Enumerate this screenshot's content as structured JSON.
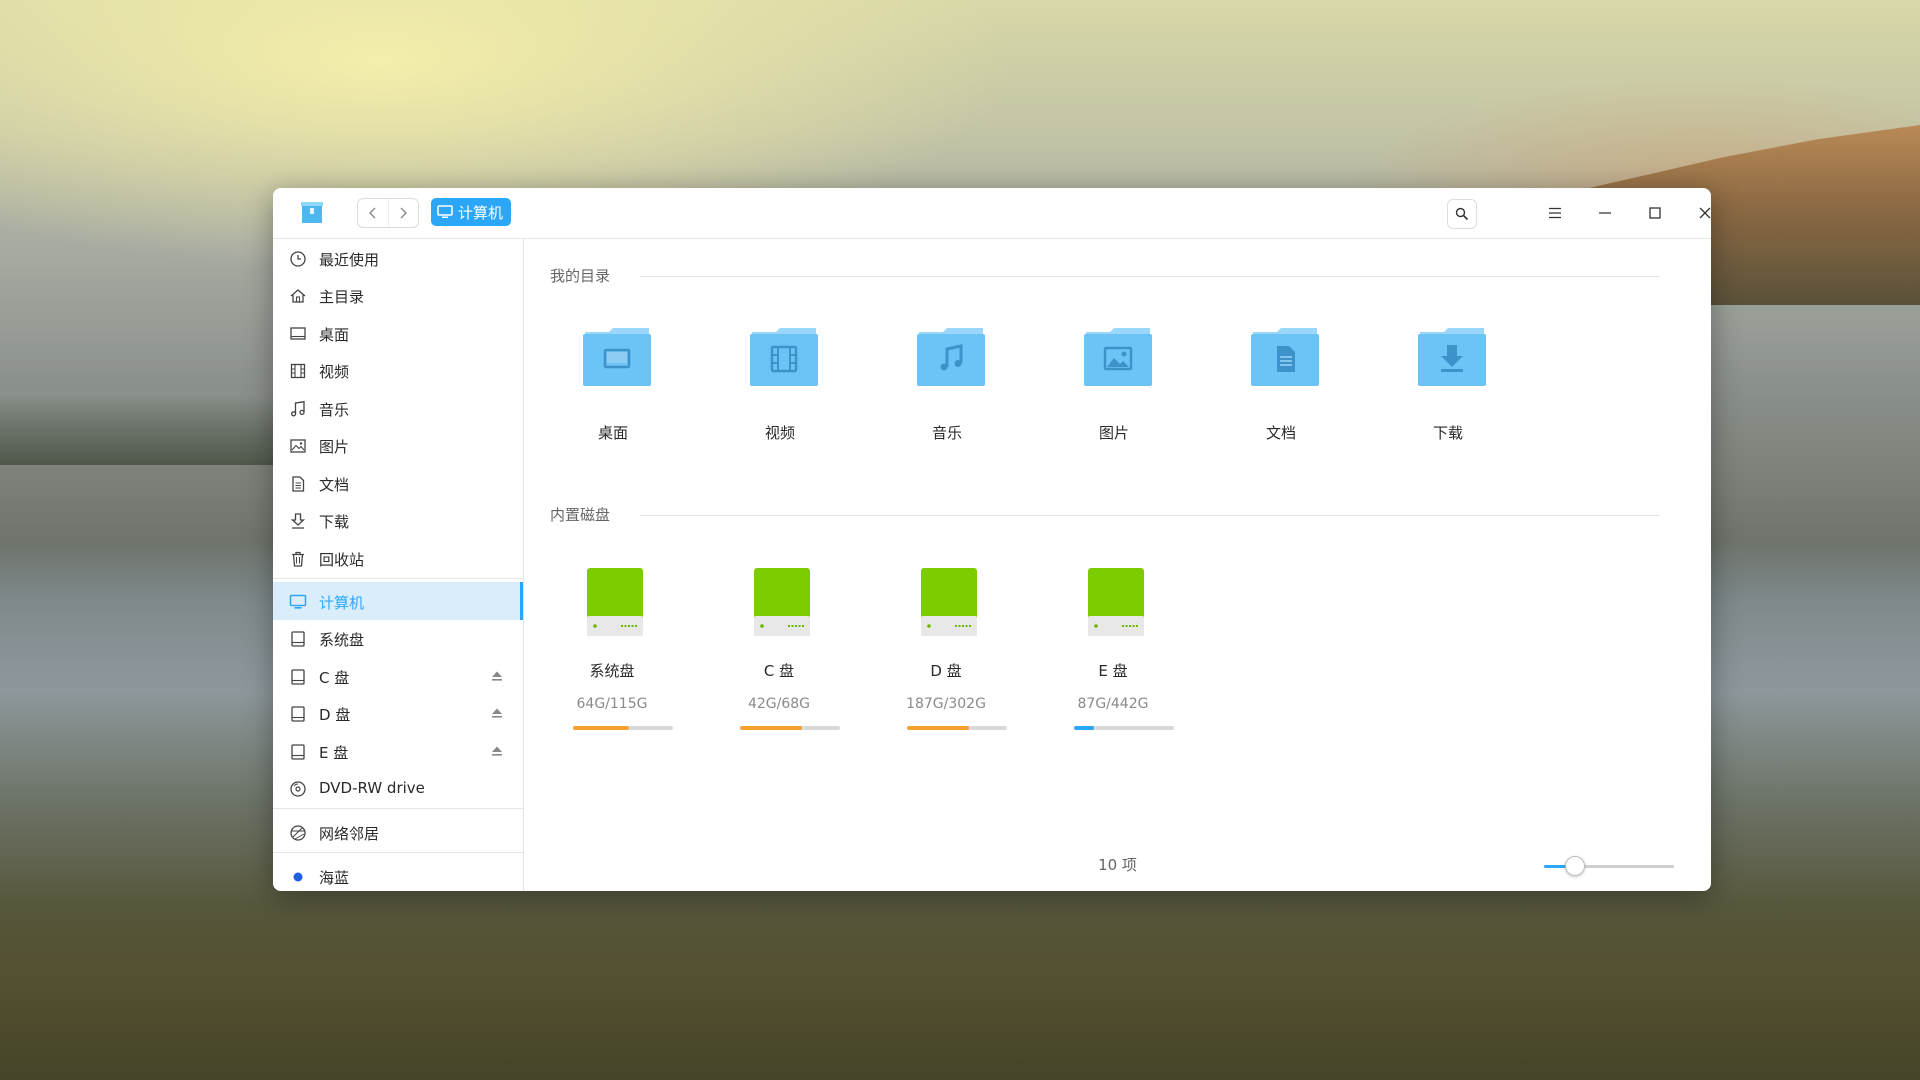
{
  "window": {
    "breadcrumb": "计算机",
    "controls": [
      "search-icon",
      "menu-icon",
      "minimize-icon",
      "maximize-icon",
      "close-icon"
    ]
  },
  "sidebar": {
    "items": [
      {
        "label": "最近使用",
        "icon": "clock-icon"
      },
      {
        "label": "主目录",
        "icon": "home-icon"
      },
      {
        "label": "桌面",
        "icon": "desktop-icon"
      },
      {
        "label": "视频",
        "icon": "video-icon"
      },
      {
        "label": "音乐",
        "icon": "music-icon"
      },
      {
        "label": "图片",
        "icon": "image-icon"
      },
      {
        "label": "文档",
        "icon": "document-icon"
      },
      {
        "label": "下载",
        "icon": "download-icon"
      },
      {
        "label": "回收站",
        "icon": "trash-icon"
      },
      {
        "label": "计算机",
        "icon": "computer-icon",
        "active": true
      },
      {
        "label": "系统盘",
        "icon": "disk-icon"
      },
      {
        "label": "C 盘",
        "icon": "disk-icon",
        "eject": true
      },
      {
        "label": "D 盘",
        "icon": "disk-icon",
        "eject": true
      },
      {
        "label": "E 盘",
        "icon": "disk-icon",
        "eject": true
      },
      {
        "label": "DVD-RW drive",
        "icon": "optical-drive-icon"
      },
      {
        "label": "网络邻居",
        "icon": "network-icon"
      },
      {
        "label": "海蓝",
        "icon": "tag-dot-icon",
        "color": "#2060e0"
      }
    ]
  },
  "content": {
    "my_dirs_title": "我的目录",
    "folders": [
      {
        "label": "桌面",
        "icon": "desktop-folder-icon"
      },
      {
        "label": "视频",
        "icon": "video-folder-icon"
      },
      {
        "label": "音乐",
        "icon": "music-folder-icon"
      },
      {
        "label": "图片",
        "icon": "picture-folder-icon"
      },
      {
        "label": "文档",
        "icon": "document-folder-icon"
      },
      {
        "label": "下载",
        "icon": "download-folder-icon"
      }
    ],
    "disks_title": "内置磁盘",
    "disks": [
      {
        "label": "系统盘",
        "usage": "64G/115G",
        "fraction": 0.556,
        "bar_color": "#f5a030"
      },
      {
        "label": "C 盘",
        "usage": "42G/68G",
        "fraction": 0.618,
        "bar_color": "#f5a030"
      },
      {
        "label": "D 盘",
        "usage": "187G/302G",
        "fraction": 0.619,
        "bar_color": "#f5a030"
      },
      {
        "label": "E 盘",
        "usage": "87G/442G",
        "fraction": 0.197,
        "bar_color": "#2ca7f8"
      }
    ]
  },
  "status": {
    "item_count": "10 项",
    "zoom_level": 0.23
  },
  "colors": {
    "accent": "#2ca7f8",
    "folder_blue": "#6cc3f5",
    "disk_green": "#7dcc00",
    "warn_orange": "#f5a030"
  }
}
